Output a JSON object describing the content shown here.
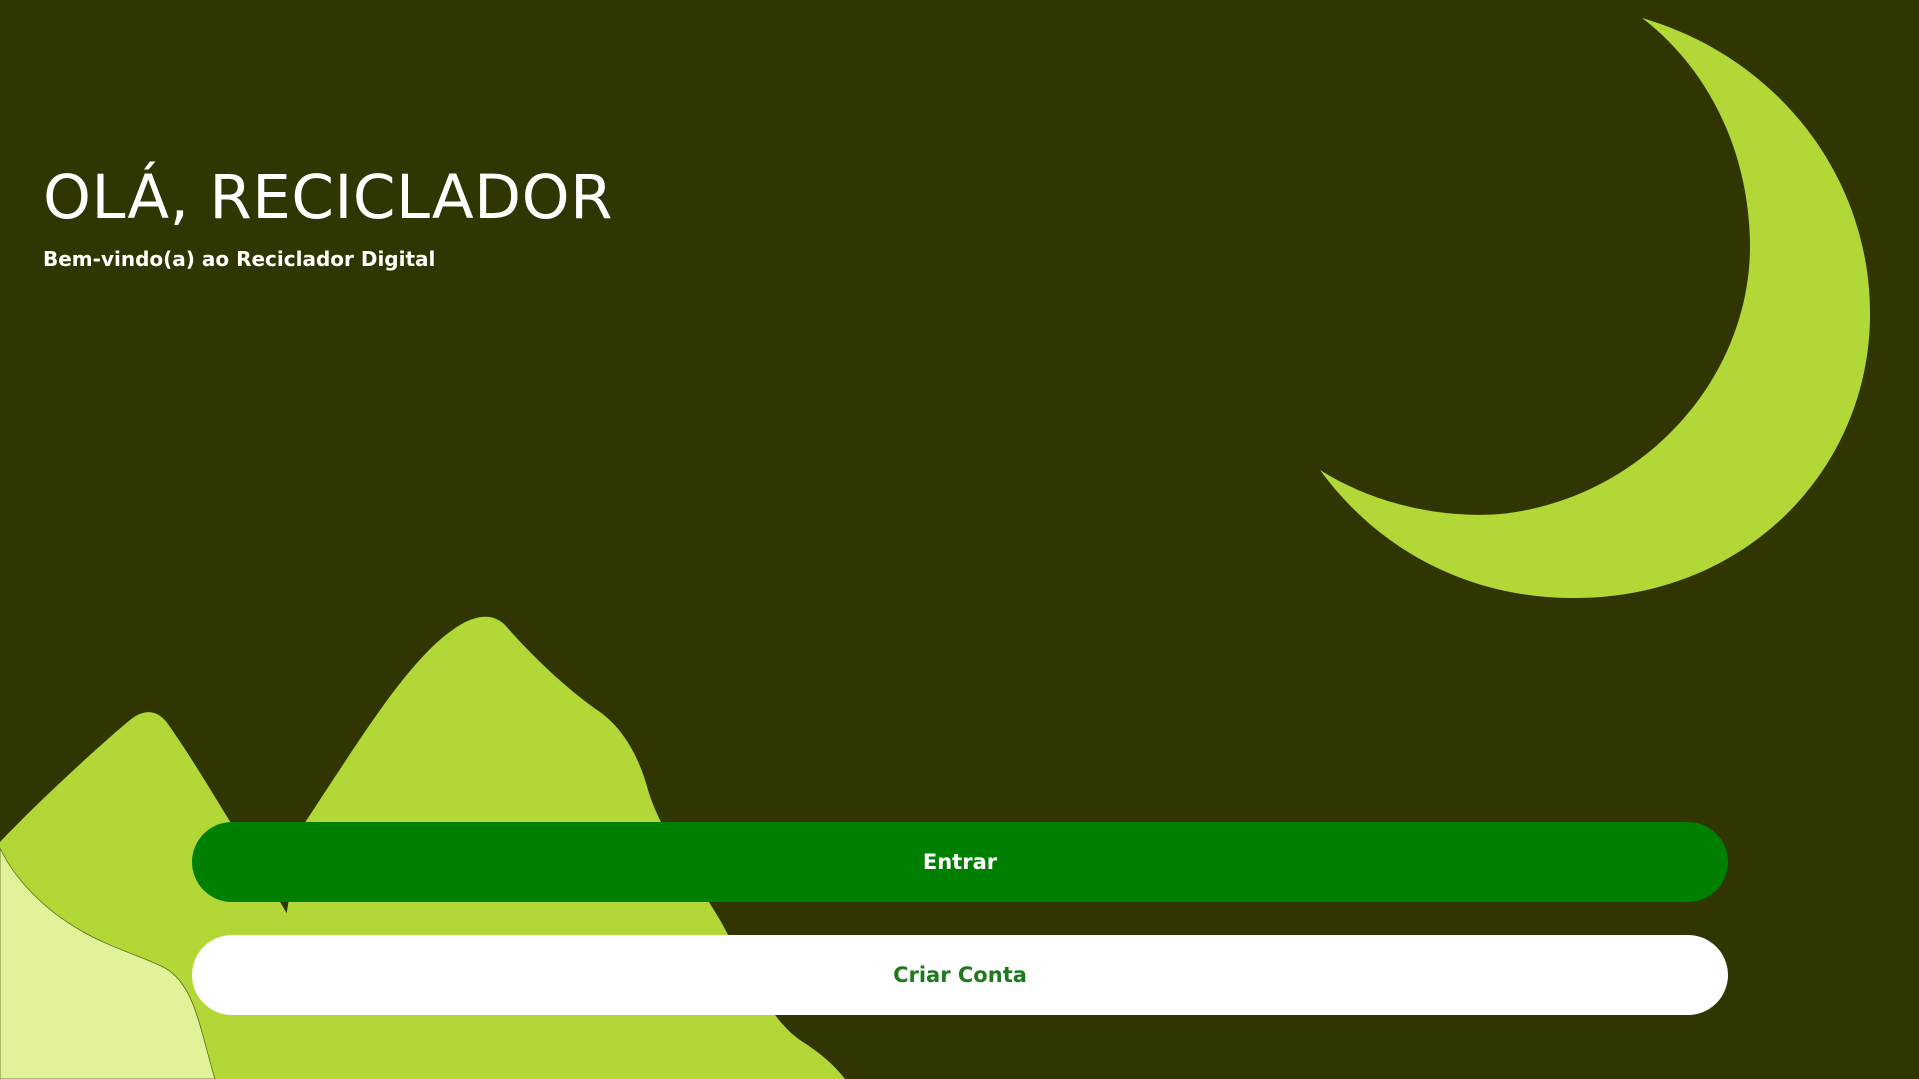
{
  "header": {
    "title": "OLÁ, RECICLADOR",
    "subtitle": "Bem-vindo(a) ao Reciclador Digital"
  },
  "actions": {
    "login_label": "Entrar",
    "signup_label": "Criar Conta"
  },
  "colors": {
    "background": "#303502",
    "accent_light_green": "#b1d836",
    "pale_green": "#e2f298",
    "primary_button": "#008000",
    "secondary_button_text": "#1f7a1f"
  },
  "icons": [
    "crescent-moon-illustration",
    "mountains-illustration"
  ]
}
